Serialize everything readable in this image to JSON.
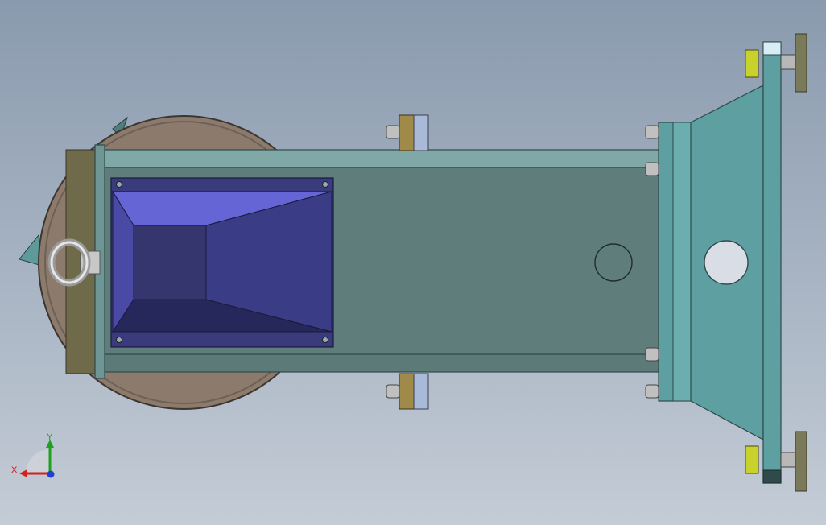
{
  "viewport": {
    "background_top": "#8a9aae",
    "background_bottom": "#c4ccd6"
  },
  "model": {
    "colors": {
      "frame_teal": "#5f7d7b",
      "frame_light": "#7fa8a6",
      "bracket_teal": "#5e9fa1",
      "plate_edge": "#2e4a4a",
      "hopper_dark": "#2e2f66",
      "hopper_mid": "#3a3b7c",
      "hopper_light": "#6565d6",
      "drum": "#8c7a6d",
      "drum_edge": "#3d3530",
      "bolt_yellow": "#c8d22a",
      "pad_olive": "#7a7a5a"
    }
  },
  "triad": {
    "x_label": "X",
    "y_label": "Y",
    "x_color": "#d02020",
    "y_color": "#20a020",
    "z_color": "#2040d0"
  }
}
